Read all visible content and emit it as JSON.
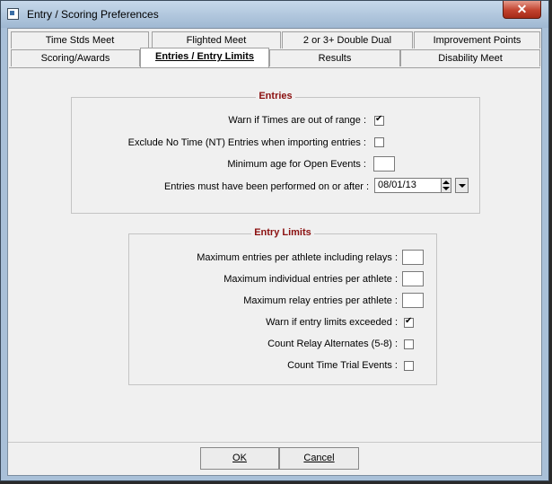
{
  "window": {
    "title": "Entry / Scoring Preferences",
    "close_label": "✕"
  },
  "tabs": {
    "row1": [
      {
        "label": "Time Stds Meet"
      },
      {
        "label": "Flighted Meet"
      },
      {
        "label": "2 or 3+ Double Dual"
      },
      {
        "label": "Improvement Points"
      }
    ],
    "row2": [
      {
        "label": "Scoring/Awards"
      },
      {
        "label": "Entries / Entry Limits",
        "active": true
      },
      {
        "label": "Results"
      },
      {
        "label": "Disability Meet"
      }
    ]
  },
  "entries": {
    "title": "Entries",
    "warn_times_label": "Warn if Times are out of range :",
    "warn_times_checked": true,
    "exclude_nt_label": "Exclude No Time (NT) Entries when importing entries :",
    "exclude_nt_checked": false,
    "min_age_label": "Minimum age for Open Events :",
    "min_age_value": "",
    "performed_after_label": "Entries must have been performed on or after :",
    "performed_after_value": "08/01/13"
  },
  "entry_limits": {
    "title": "Entry Limits",
    "max_entries_label": "Maximum entries per athlete including relays :",
    "max_entries_value": "",
    "max_individual_label": "Maximum individual entries per athlete :",
    "max_individual_value": "",
    "max_relay_label": "Maximum relay entries per athlete :",
    "max_relay_value": "",
    "warn_exceeded_label": "Warn if entry limits exceeded :",
    "warn_exceeded_checked": true,
    "relay_alternates_label": "Count Relay Alternates (5-8) :",
    "relay_alternates_checked": false,
    "time_trial_label": "Count Time Trial Events :",
    "time_trial_checked": false
  },
  "buttons": {
    "ok": "OK",
    "cancel": "Cancel"
  }
}
